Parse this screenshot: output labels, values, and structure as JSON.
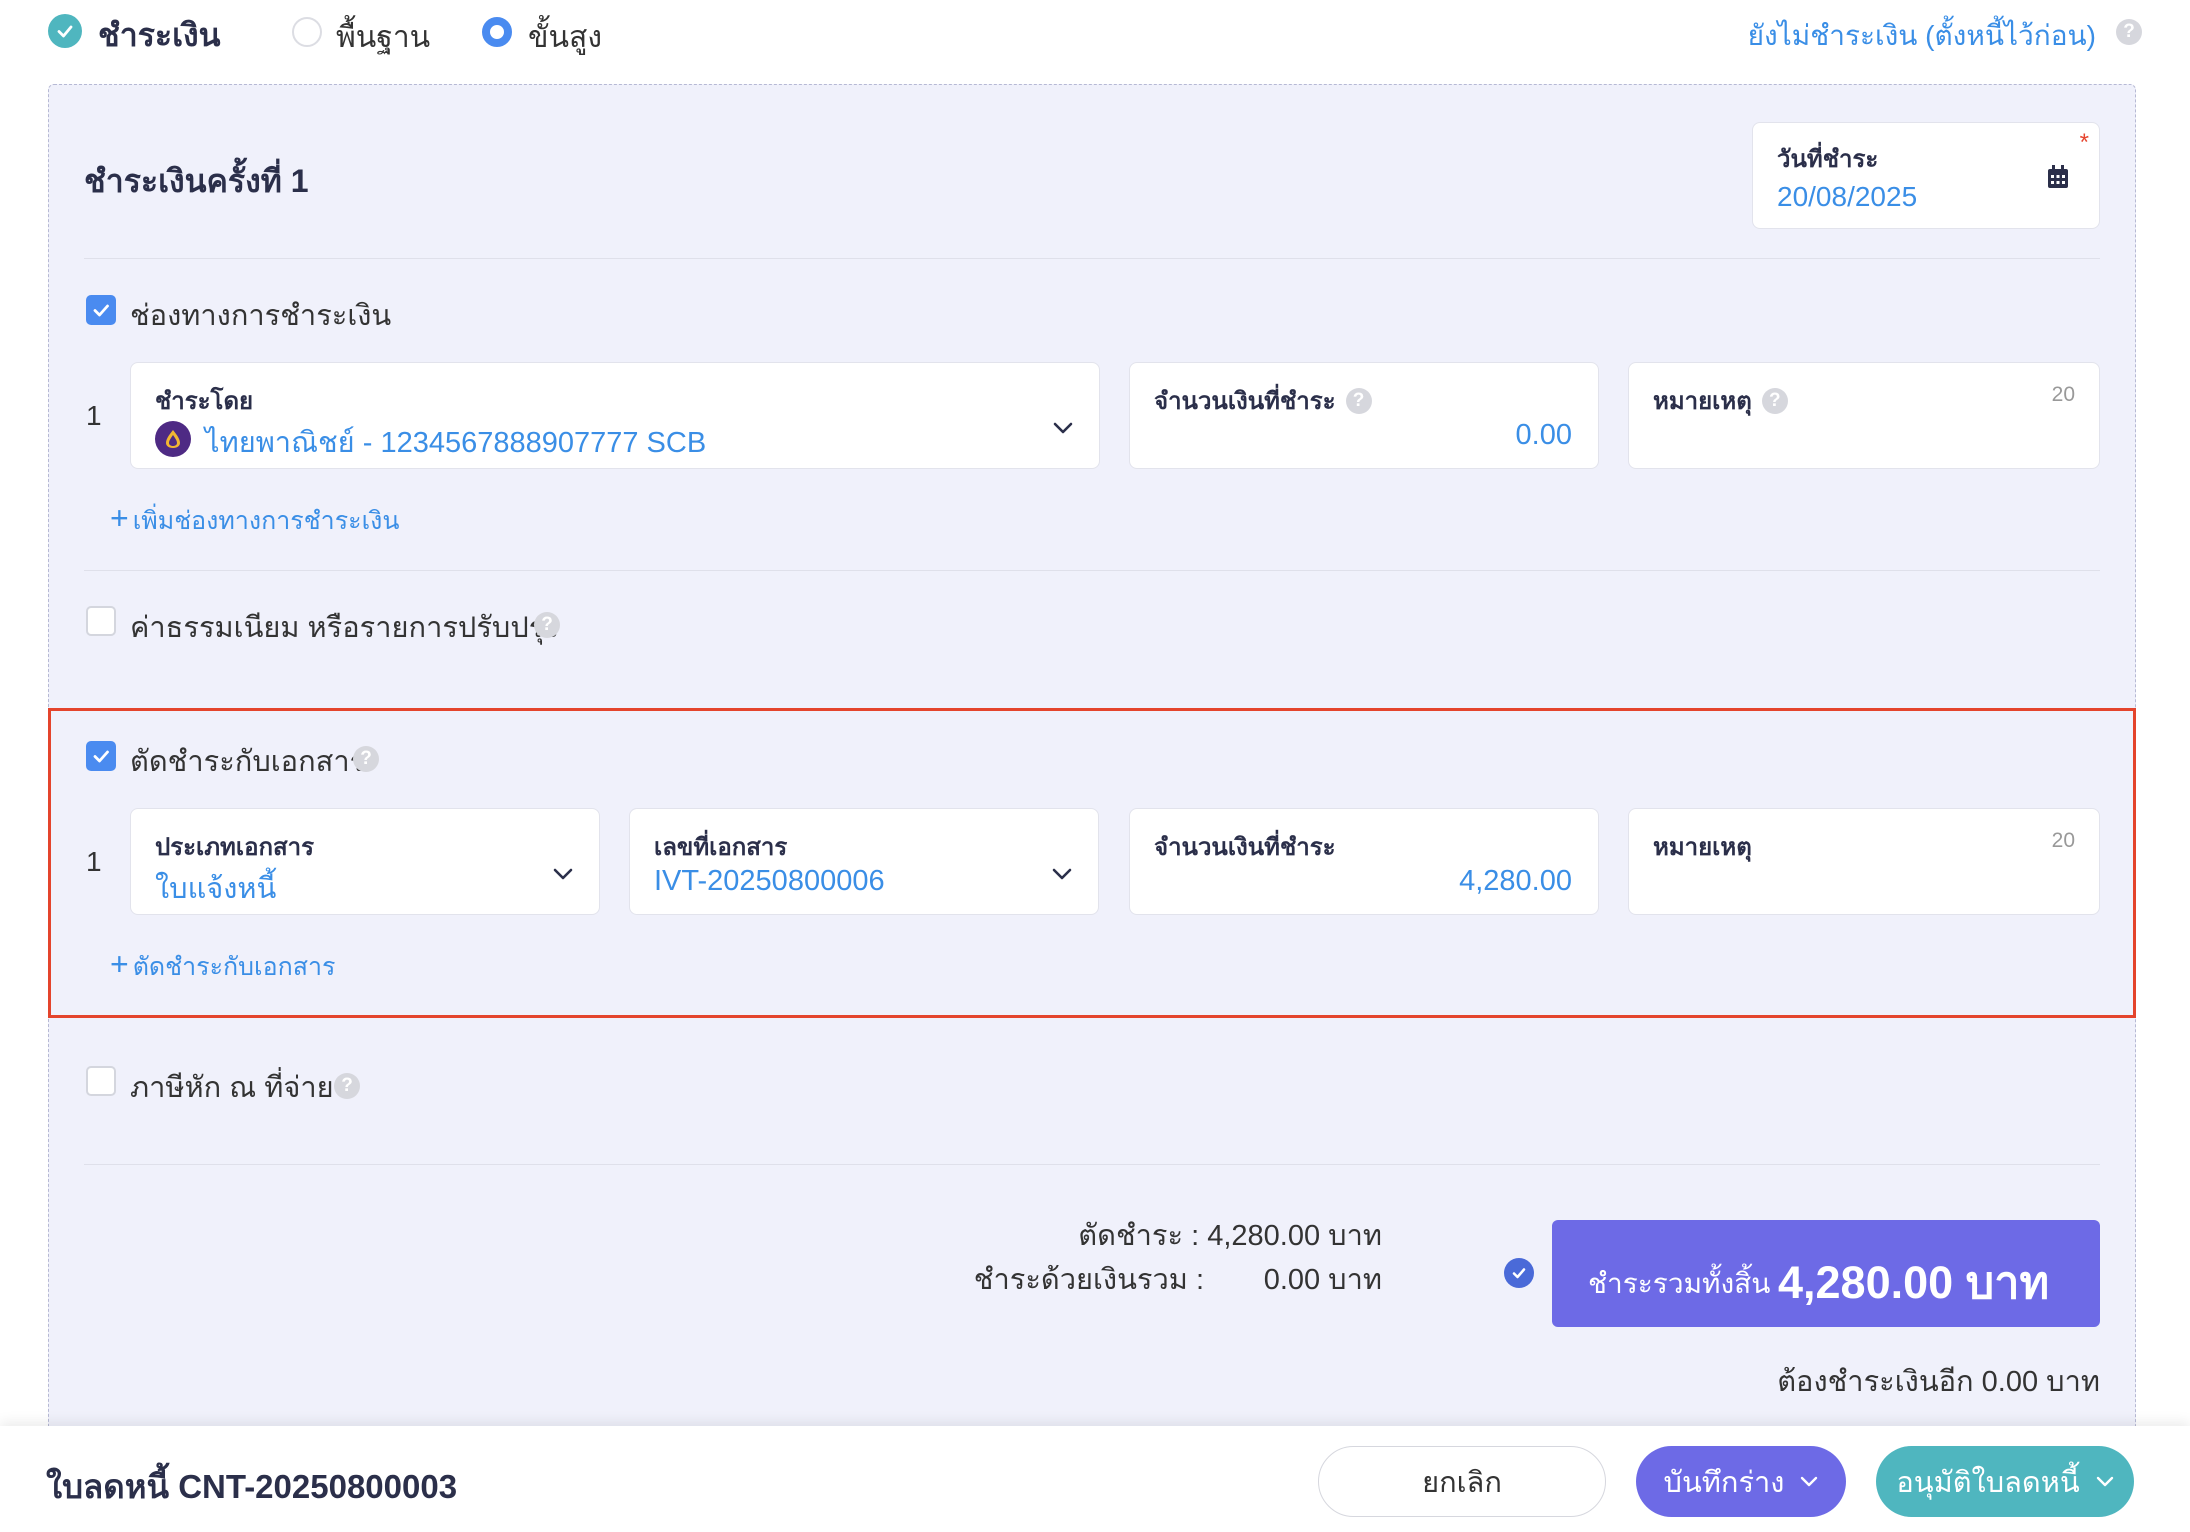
{
  "header": {
    "title": "ชำระเงิน",
    "mode_basic": "พื้นฐาน",
    "mode_advanced": "ขั้นสูง",
    "selected_mode": "advanced",
    "deferred_link": "ยังไม่ชำระเงิน (ตั้งหนี้ไว้ก่อน)"
  },
  "payment": {
    "title": "ชำระเงินครั้งที่ 1",
    "date_label": "วันที่ชำระ",
    "date_value": "20/08/2025",
    "required_mark": "*"
  },
  "channels": {
    "label": "ช่องทางการชำระเงิน",
    "checked": true,
    "rows": [
      {
        "num": "1",
        "pay_by_label": "ชำระโดย",
        "pay_by_value": "ไทยพาณิชย์ - 1234567888907777 SCB",
        "amount_label": "จำนวนเงินที่ชำระ",
        "amount_value": "0.00",
        "note_label": "หมายเหตุ",
        "note_counter": "20"
      }
    ],
    "add_label": "เพิ่มช่องทางการชำระเงิน"
  },
  "fees": {
    "label": "ค่าธรรมเนียม หรือรายการปรับปรุง",
    "checked": false
  },
  "offset": {
    "label": "ตัดชำระกับเอกสาร",
    "checked": true,
    "rows": [
      {
        "num": "1",
        "doc_type_label": "ประเภทเอกสาร",
        "doc_type_value": "ใบแจ้งหนี้",
        "doc_no_label": "เลขที่เอกสาร",
        "doc_no_value": "IVT-20250800006",
        "amount_label": "จำนวนเงินที่ชำระ",
        "amount_value": "4,280.00",
        "note_label": "หมายเหตุ",
        "note_counter": "20"
      }
    ],
    "add_label": "ตัดชำระกับเอกสาร"
  },
  "withholding": {
    "label": "ภาษีหัก ณ ที่จ่าย",
    "checked": false
  },
  "summary": {
    "offset_line": "ตัดชำระ :  4,280.00 บาท",
    "paid_label": "ชำระด้วยเงินรวม :",
    "paid_value": "0.00 บาท",
    "total_label": "ชำระรวมทั้งสิ้น",
    "total_value": "4,280.00 บาท",
    "remaining": "ต้องชำระเงินอีก 0.00 บาท"
  },
  "footer": {
    "doc_title": "ใบลดหนี้ CNT-20250800003",
    "cancel": "ยกเลิก",
    "save_draft": "บันทึกร่าง",
    "approve": "อนุมัติใบลดหนี้"
  },
  "icons": {
    "help": "?",
    "plus": "+"
  },
  "colors": {
    "accent_blue": "#3a8ee6",
    "primary_purple": "#6d6ae6",
    "teal": "#4fb6bf",
    "highlight_red": "#e4442c"
  }
}
